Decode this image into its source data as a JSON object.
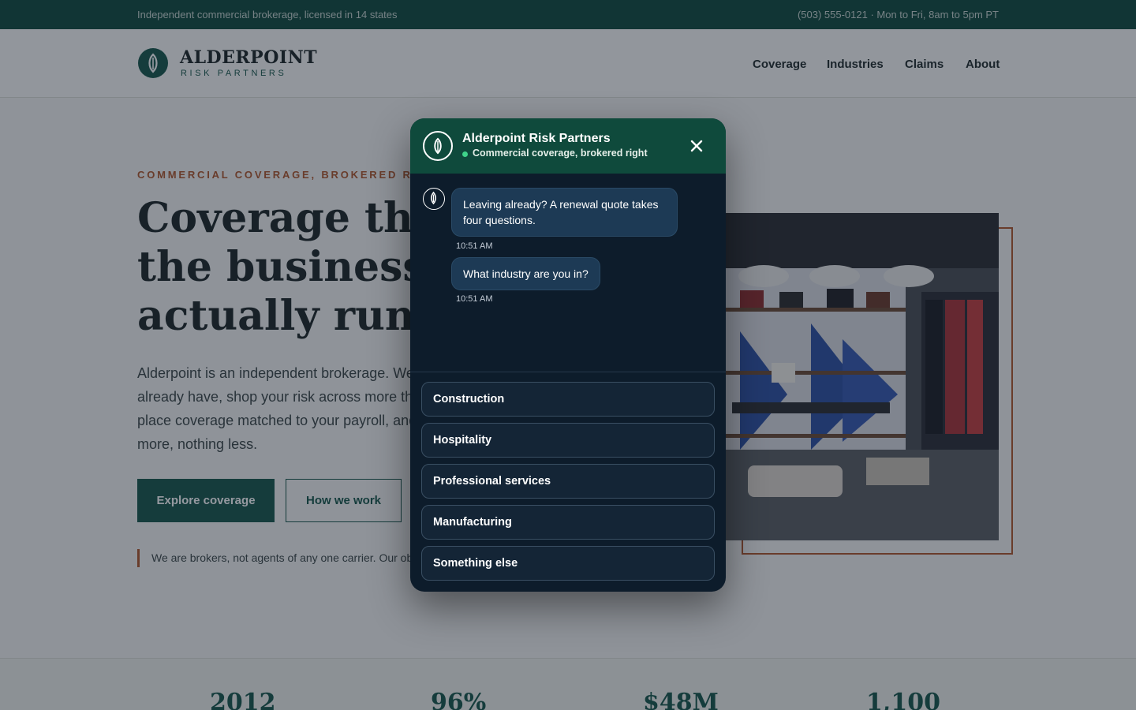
{
  "topbar": {
    "tagline": "Independent commercial brokerage, licensed in 14 states",
    "contact": "(503) 555-0121 · Mon to Fri, 8am to 5pm PT"
  },
  "brand": {
    "name": "ALDERPOINT",
    "sub": "RISK PARTNERS",
    "color": "#17574a"
  },
  "nav": [
    {
      "label": "Coverage"
    },
    {
      "label": "Industries"
    },
    {
      "label": "Claims"
    },
    {
      "label": "About"
    }
  ],
  "hero": {
    "eyebrow": "COMMERCIAL COVERAGE, BROKERED RIGHT",
    "headline": "Coverage that fits the business you actually run",
    "lead": "Alderpoint is an independent brokerage. We read the policies you already have, shop your risk across more than thirty carriers, and place coverage matched to your payroll, and your lease. Nothing more, nothing less.",
    "primary_cta": "Explore coverage",
    "secondary_cta": "How we work",
    "quote": "We are brokers, not agents of any one carrier. Our obligation is to you."
  },
  "stats": [
    "2012",
    "96%",
    "$48M",
    "1,100"
  ],
  "chat": {
    "title": "Alderpoint Risk Partners",
    "status": "Commercial coverage, brokered right",
    "messages": [
      {
        "text": "Leaving already? A renewal quote takes four questions.",
        "time": "10:51 AM"
      },
      {
        "text": "What industry are you in?",
        "time": "10:51 AM"
      }
    ],
    "options": [
      {
        "label": "Construction"
      },
      {
        "label": "Hospitality"
      },
      {
        "label": "Professional services"
      },
      {
        "label": "Manufacturing"
      },
      {
        "label": "Something else"
      }
    ]
  }
}
